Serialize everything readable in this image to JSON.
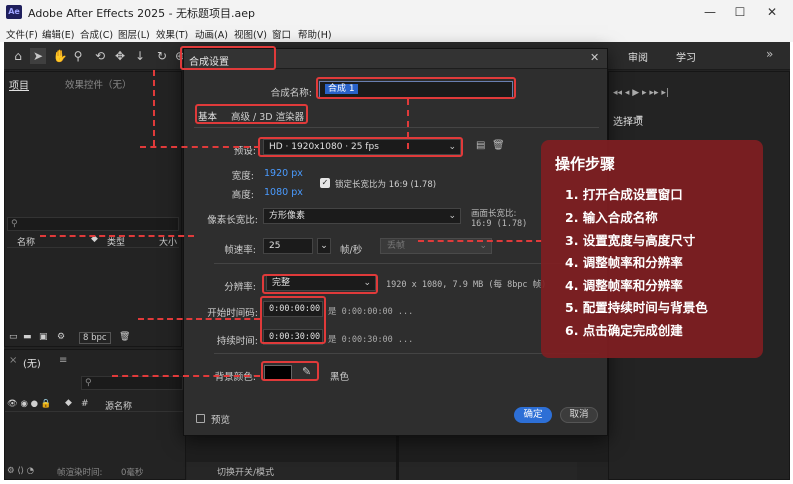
{
  "window": {
    "app_icon": "Ae",
    "title": "Adobe After Effects 2025 - 无标题项目.aep",
    "minimize": "—",
    "maximize": "☐",
    "close": "✕"
  },
  "menu": [
    "文件(F)",
    "编辑(E)",
    "合成(C)",
    "图层(L)",
    "效果(T)",
    "动画(A)",
    "视图(V)",
    "窗口",
    "帮助(H)"
  ],
  "workspace_tabs": [
    "审阅",
    "学习"
  ],
  "project_panel": {
    "tab": "项目",
    "effects_tab": "效果控件（无）",
    "columns": [
      "名称",
      "类型",
      "大小"
    ],
    "bpc": "8 bpc"
  },
  "timeline_panel": {
    "title": "(无)",
    "source_name": "源名称",
    "render_time_label": "帧渲染时间:",
    "render_time_value": "0毫秒",
    "toggle_label": "切换开关/模式"
  },
  "right_panel": {
    "title": "选择项"
  },
  "dialog": {
    "title": "合成设置",
    "comp_name_label": "合成名称:",
    "comp_name_value": "合成 1",
    "tab_basic": "基本",
    "tab_advanced": "高级 / 3D 渲染器",
    "preset_label": "预设:",
    "preset_value": "HD · 1920x1080 · 25 fps",
    "width_label": "宽度:",
    "width_value": "1920 px",
    "height_label": "高度:",
    "height_value": "1080 px",
    "lock_ratio_label": "锁定长宽比为 16:9 (1.78)",
    "pixel_aspect_label": "像素长宽比:",
    "pixel_aspect_value": "方形像素",
    "frame_aspect_label": "画面长宽比:",
    "frame_aspect_value": "16:9 (1.78)",
    "frame_rate_label": "帧速率:",
    "frame_rate_value": "25",
    "frame_rate_unit": "帧/秒",
    "drop_frame_value": "丢帧",
    "resolution_label": "分辨率:",
    "resolution_value": "完整",
    "resolution_info": "1920 x 1080, 7.9 MB (每 8bpc 帧)",
    "start_timecode_label": "开始时间码:",
    "start_timecode_value": "0:00:00:00",
    "start_timecode_note": "是 0:00:00:00 ...",
    "duration_label": "持续时间:",
    "duration_value": "0:00:30:00",
    "duration_note": "是 0:00:30:00 ...",
    "bg_color_label": "背景颜色:",
    "bg_color_name": "黑色",
    "bg_color_hex": "#000000",
    "preview_label": "预览",
    "ok_label": "确定",
    "cancel_label": "取消"
  },
  "steps": {
    "title": "操作步骤",
    "items": [
      "1. 打开合成设置窗口",
      "2. 输入合成名称",
      "3. 设置宽度与高度尺寸",
      "4. 调整帧率和分辨率",
      "4. 调整帧率和分辨率",
      "5. 配置持续时间与背景色",
      "6. 点击确定完成创建"
    ]
  },
  "colors": {
    "accent_red": "#e03a3a",
    "steps_bg": "#801e22",
    "blue_value": "#4a9bff",
    "ok_button": "#2d6fd6"
  }
}
